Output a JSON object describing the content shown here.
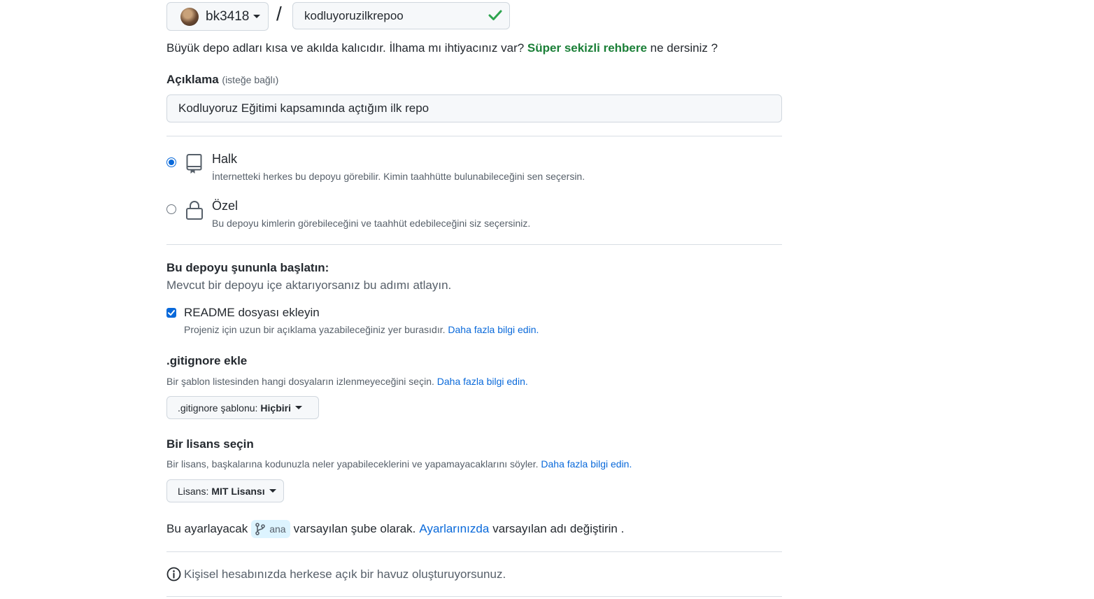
{
  "owner": {
    "name": "bk3418"
  },
  "separator": "/",
  "repo": {
    "name": "kodluyoruzilkrepoo"
  },
  "name_hint": {
    "before": "Büyük depo adları kısa ve akılda kalıcıdır. İlhama mı ihtiyacınız var? ",
    "link": "Süper sekizli rehbere",
    "after": " ne dersiniz ?"
  },
  "description": {
    "label": "Açıklama",
    "optional": "(isteğe bağlı)",
    "value": "Kodluyoruz Eğitimi kapsamında açtığım ilk repo"
  },
  "visibility": {
    "public": {
      "title": "Halk",
      "desc": "İnternetteki herkes bu depoyu görebilir. Kimin taahhütte bulunabileceğini sen seçersin.",
      "selected": true
    },
    "private": {
      "title": "Özel",
      "desc": "Bu depoyu kimlerin görebileceğini ve taahhüt edebileceğini siz seçersiniz.",
      "selected": false
    }
  },
  "init": {
    "title": "Bu depoyu şununla başlatın:",
    "desc": "Mevcut bir depoyu içe aktarıyorsanız bu adımı atlayın."
  },
  "readme": {
    "label": "README dosyası ekleyin",
    "checked": true,
    "desc": "Projeniz için uzun bir açıklama yazabileceğiniz yer burasıdır. ",
    "link": "Daha fazla bilgi edin."
  },
  "gitignore": {
    "title": ".gitignore ekle",
    "desc": "Bir şablon listesinden hangi dosyaların izlenmeyeceğini seçin. ",
    "link": "Daha fazla bilgi edin.",
    "dropdown_prefix": ".gitignore şablonu:",
    "dropdown_value": "Hiçbiri"
  },
  "license": {
    "title": "Bir lisans seçin",
    "desc": "Bir lisans, başkalarına kodunuzla neler yapabileceklerini ve yapamayacaklarını söyler. ",
    "link": "Daha fazla bilgi edin.",
    "dropdown_prefix": "Lisans:",
    "dropdown_value": "MIT Lisansı"
  },
  "branch": {
    "before": "Bu ayarlayacak",
    "name": "ana",
    "middle": "varsayılan şube olarak.",
    "link": "Ayarlarınızda",
    "after": "varsayılan adı değiştirin ."
  },
  "info": {
    "text": "Kişisel hesabınızda herkese açık bir havuz oluşturuyorsunuz."
  },
  "colors": {
    "accent": "#0969da",
    "success": "#1a7f37",
    "muted": "#57606a"
  }
}
